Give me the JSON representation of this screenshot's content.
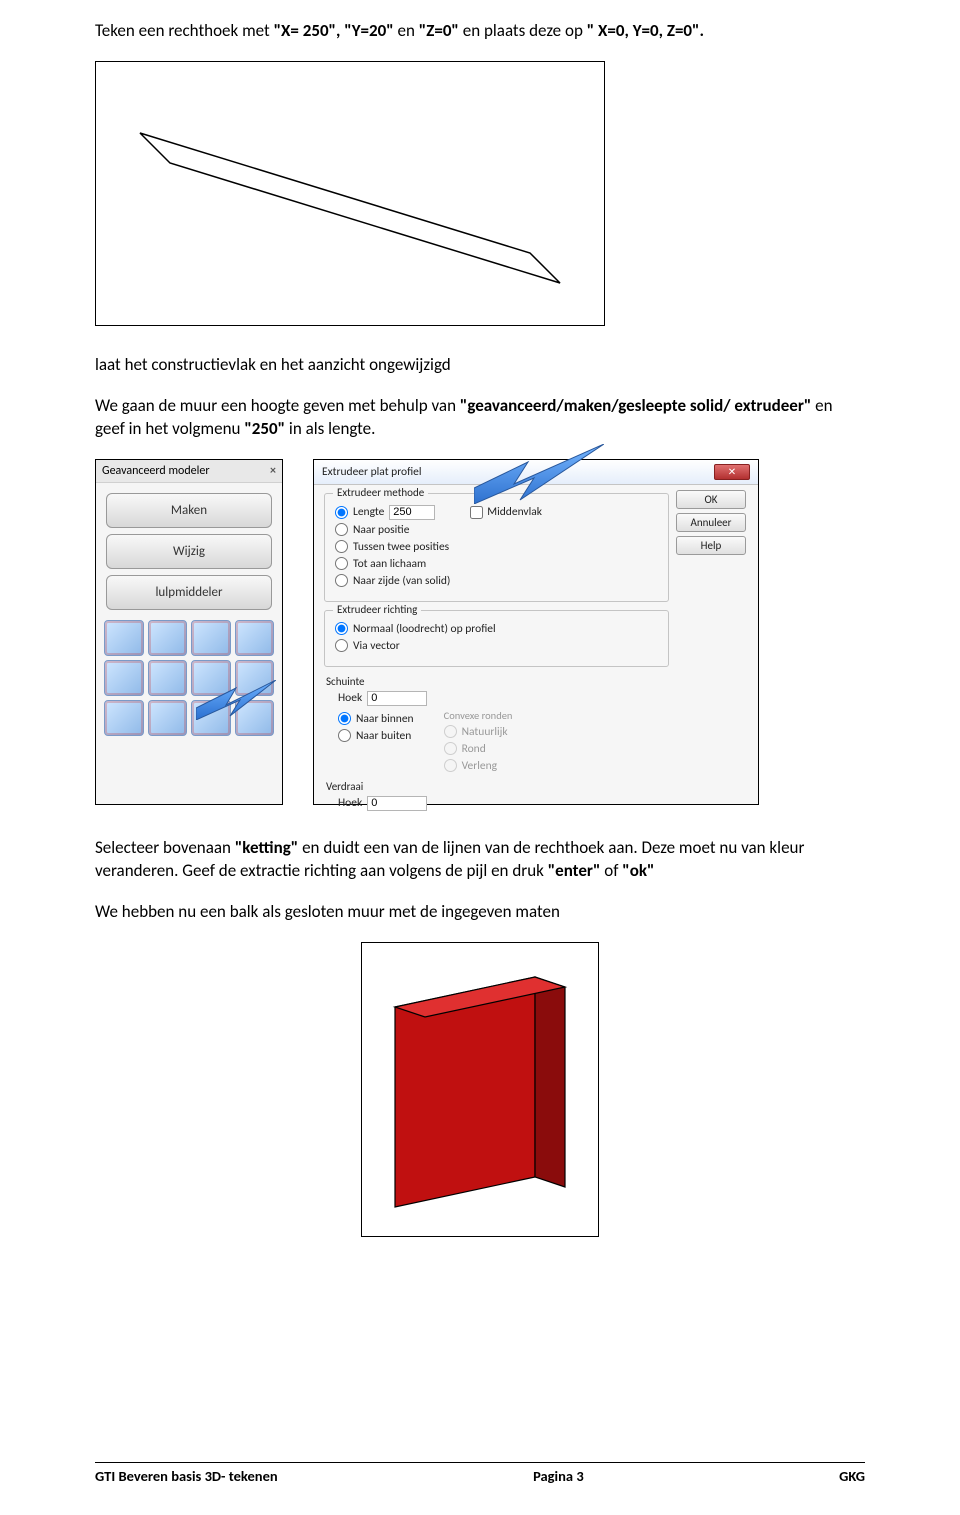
{
  "para1": {
    "t1": "Teken een rechthoek met ",
    "b1": "\"X= 250\", \"Y=20\"",
    "t2": " en ",
    "b2": "\"Z=0\"",
    "t3": " en plaats deze op ",
    "b3": "\" X=0, Y=0, Z=0\"."
  },
  "para2": "laat het constructievlak en het aanzicht ongewijzigd",
  "para3": {
    "t1": "We gaan de muur een hoogte geven met behulp van ",
    "b1": "\"geavanceerd/maken/gesleepte solid/ extrudeer\"",
    "t2": " en geef in het volgmenu ",
    "b2": "\"250\"",
    "t3": " in als lengte."
  },
  "toolbox": {
    "title": "Geavanceerd modeler",
    "close": "×",
    "btn1": "Maken",
    "btn2": "Wijzig",
    "btn3": "lulpmiddeler"
  },
  "dialog": {
    "title": "Extrudeer plat profiel",
    "ok": "OK",
    "annuleer": "Annuleer",
    "help": "Help",
    "grp_methode": "Extrudeer methode",
    "r_lengte": "Lengte",
    "val_lengte": "250",
    "chk_midden": "Middenvlak",
    "r_positie": "Naar positie",
    "r_tussen": "Tussen twee posities",
    "r_lichaam": "Tot aan lichaam",
    "r_zijde": "Naar zijde (van solid)",
    "grp_richting": "Extrudeer richting",
    "r_normaal": "Normaal (loodrecht) op profiel",
    "r_vector": "Via vector",
    "grp_schuinte": "Schuinte",
    "lbl_hoek": "Hoek",
    "val_hoek": "0",
    "r_binnen": "Naar binnen",
    "r_buiten": "Naar buiten",
    "lbl_ronde": "Convexe ronden",
    "r_natuurlijk": "Natuurlijk",
    "r_rond": "Rond",
    "r_verleng": "Verleng",
    "grp_verdraai": "Verdraai",
    "val_hoek2": "0"
  },
  "para4": {
    "t1": "Selecteer bovenaan ",
    "b1": "\"ketting\"",
    "t2": " en duidt een van de lijnen van de rechthoek aan. Deze moet nu van kleur veranderen. Geef de extractie richting aan volgens de pijl en druk ",
    "b2": "\"enter\"",
    "t3": " of ",
    "b3": "\"ok\""
  },
  "para5": "We hebben nu een balk als gesloten muur met de ingegeven maten",
  "footer": {
    "left": "GTI Beveren  basis 3D- tekenen",
    "center": "Pagina 3",
    "right": "GKG"
  }
}
